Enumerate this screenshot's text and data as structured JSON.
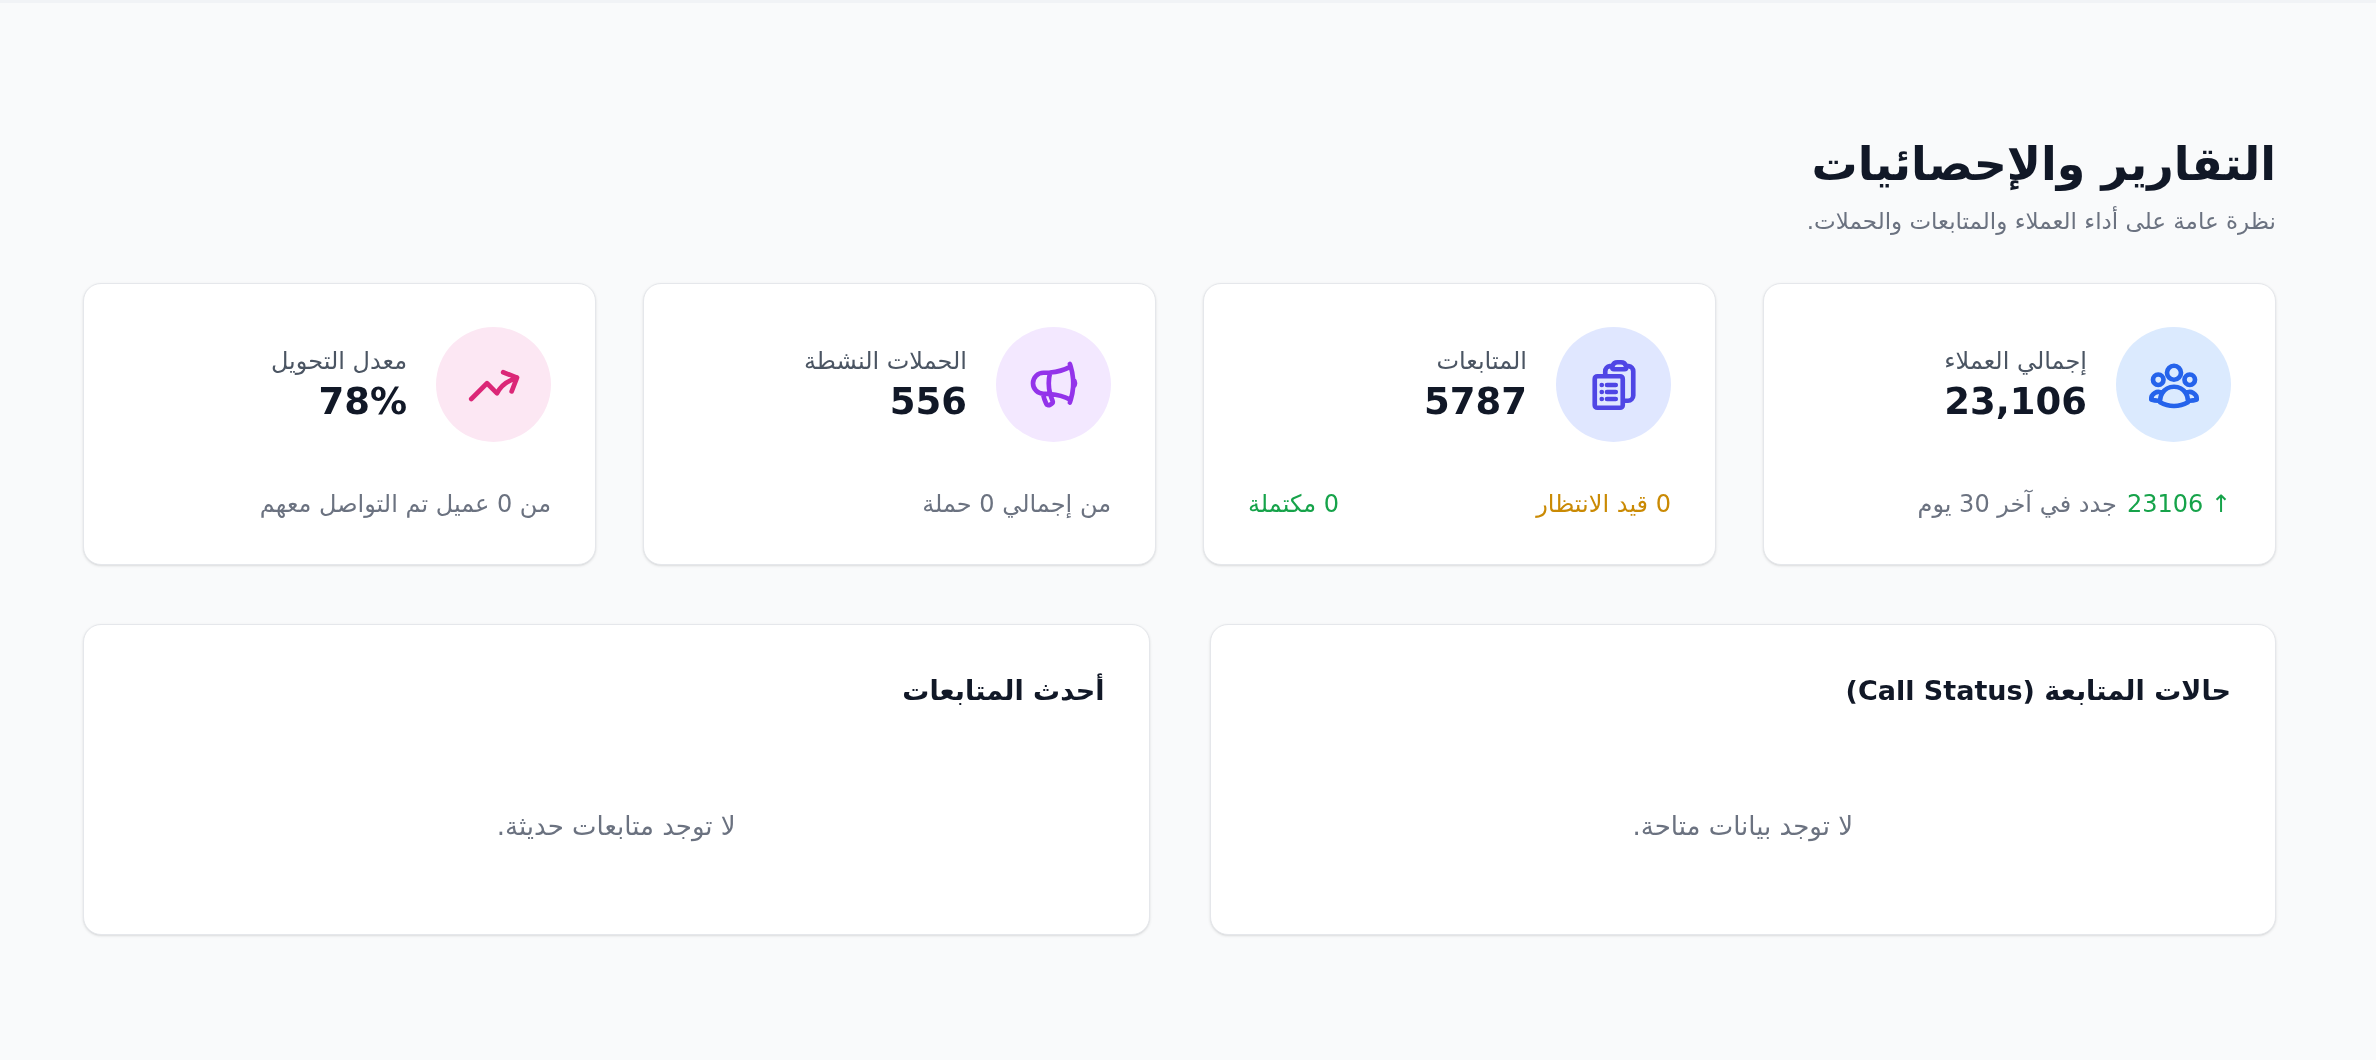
{
  "header": {
    "title": "التقارير والإحصائيات",
    "subtitle": "نظرة عامة على أداء العملاء والمتابعات والحملات."
  },
  "stat_cards": [
    {
      "kind": "customers",
      "label": "إجمالي العملاء",
      "value": "23,106",
      "footer": [
        {
          "text": "↑ 23106",
          "color": "#16a34a"
        },
        {
          "text": "جدد في آخر 30 يوم",
          "color": "#6b7280"
        }
      ]
    },
    {
      "kind": "followups",
      "label": "المتابعات",
      "value": "5787",
      "footer": [
        {
          "text": "0 قيد الانتظار",
          "color": "#ca8a04"
        },
        {
          "text": "0 مكتملة",
          "color": "#16a34a"
        }
      ]
    },
    {
      "kind": "campaigns",
      "label": "الحملات النشطة",
      "value": "556",
      "footer": [
        {
          "text": "من إجمالي 0 حملة",
          "color": "#6b7280"
        }
      ]
    },
    {
      "kind": "conversion",
      "label": "معدل التحويل",
      "value": "78%",
      "footer": [
        {
          "text": "من 0 عميل تم التواصل معهم",
          "color": "#6b7280"
        }
      ]
    }
  ],
  "panels": [
    {
      "title": "حالات المتابعة (Call Status)",
      "empty_text": "لا توجد بيانات متاحة."
    },
    {
      "title": "أحدث المتابعات",
      "empty_text": "لا توجد متابعات حديثة."
    }
  ]
}
